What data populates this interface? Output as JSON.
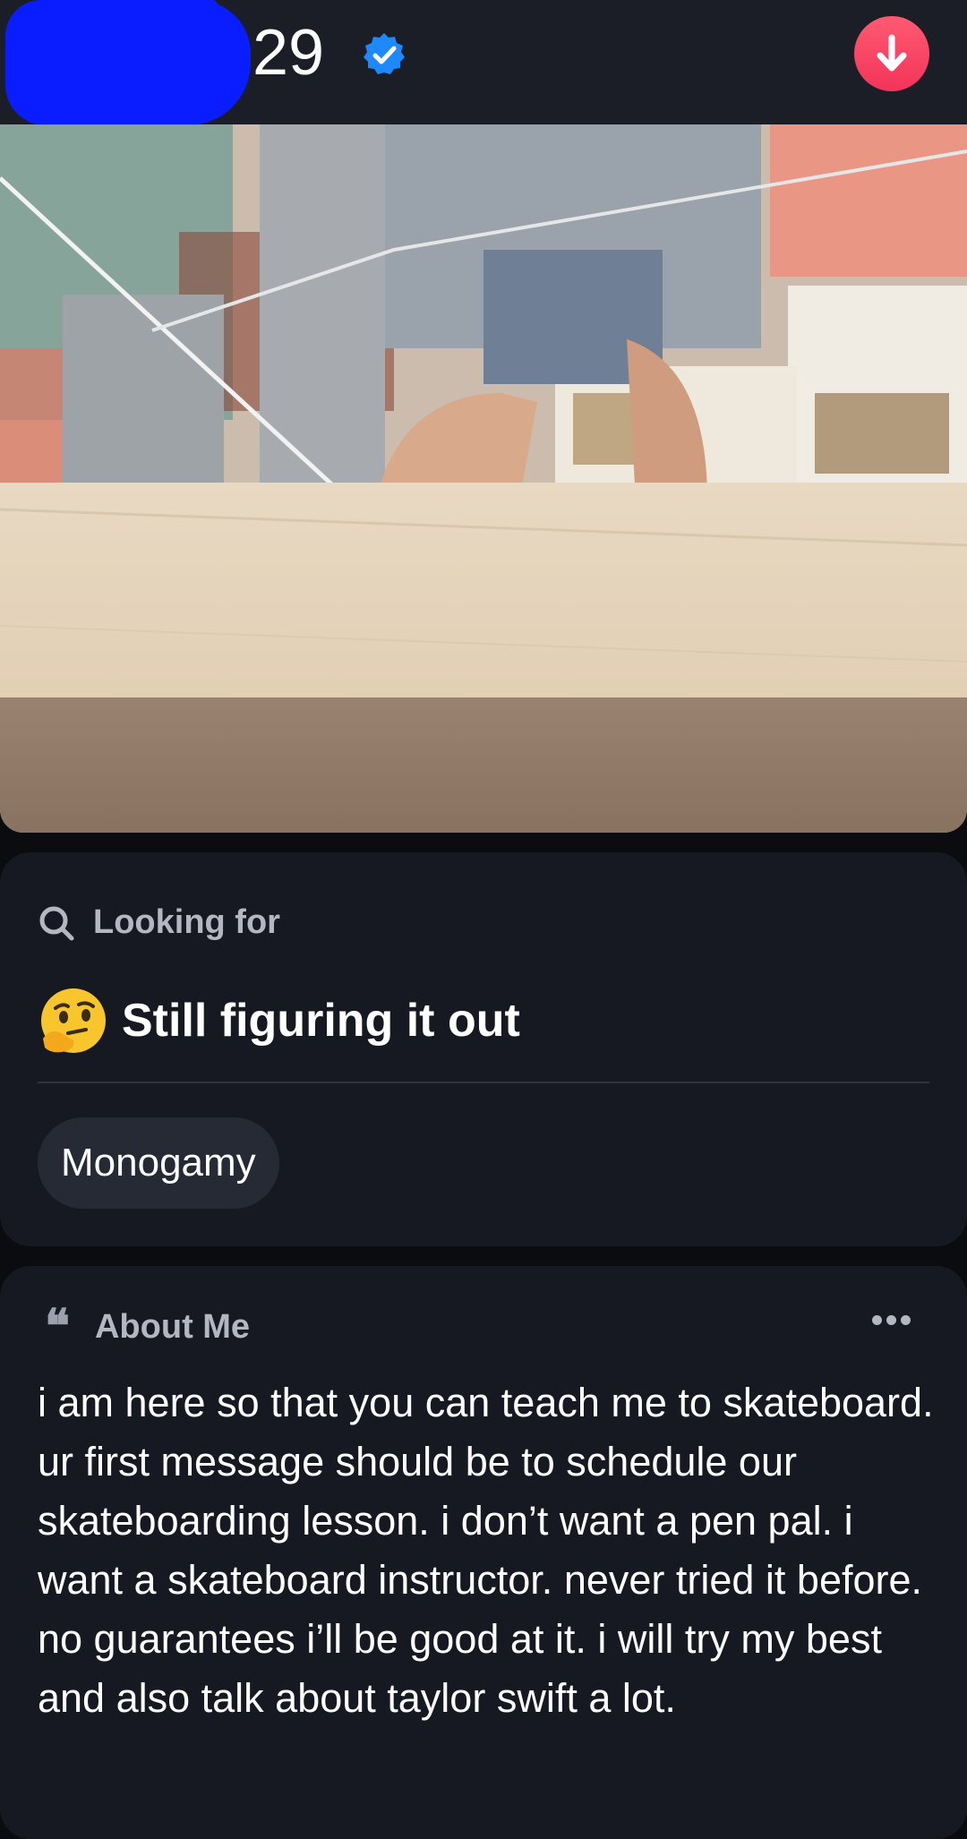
{
  "header": {
    "name_redacted": true,
    "age": "29",
    "verified": true,
    "download_button": "arrow-down-icon"
  },
  "photo": {
    "description_icon": "profile-photo"
  },
  "looking_for": {
    "label": "Looking for",
    "icon": "search-icon",
    "status_emoji": "🤔",
    "status": "Still figuring it out",
    "chip": "Monogamy"
  },
  "about": {
    "icon": "quote-icon",
    "label": "About Me",
    "more_icon": "more-dots-icon",
    "bio": "i am here so that you can teach me to skateboard. ur first message should be to schedule our skateboarding lesson. i don’t want a pen pal. i want a skateboard instructor. never tried it before. no guarantees i’ll be good at it. i will try my best and also talk about taylor swift a lot."
  },
  "colors": {
    "background": "#0b0c10",
    "card": "#161922",
    "header": "#1b1e26",
    "accent_red": "#f2345a",
    "verified_blue": "#1e88ff",
    "redaction_blue": "#0a1dff"
  }
}
